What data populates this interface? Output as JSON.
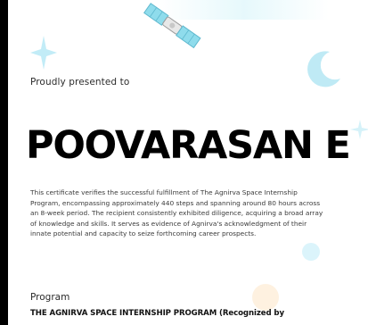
{
  "certificate": {
    "presented_text": "Proudly presented to",
    "recipient_name": "POOVARASAN E",
    "description": "This certificate verifies the successful fulfillment of The Agnirva Space Internship Program, encompassing approximately 440 steps and spanning around 80 hours across an 8-week period. The recipient consistently exhibited diligence, acquiring a broad array of knowledge and skills. It serves as evidence of Agnirva's acknowledgment of their innate potential and capacity to seize forthcoming career prospects.",
    "program_label": "Program",
    "program_name": "THE AGNIRVA SPACE INTERNSHIP PROGRAM (Recognized by"
  },
  "decorations": {
    "satellite": "satellite-icon",
    "sparkle": "sparkle-icon",
    "moon": "crescent-moon-icon"
  },
  "colors": {
    "background": "#000000",
    "card": "#ffffff",
    "text": "#000000",
    "accent_cyan": "#bfeaf5"
  }
}
